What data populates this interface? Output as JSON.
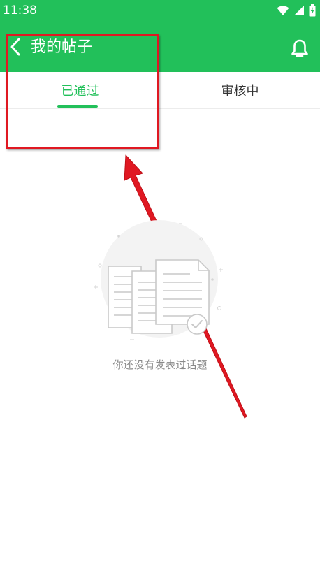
{
  "status_bar": {
    "time": "11:38",
    "icons": [
      "wifi-icon",
      "cell-signal-icon",
      "battery-charging-icon"
    ]
  },
  "header": {
    "title": "我的帖子",
    "back_icon": "chevron-left-icon",
    "notification_icon": "bell-icon"
  },
  "tabs": [
    {
      "label": "已通过",
      "active": true
    },
    {
      "label": "审核中",
      "active": false
    }
  ],
  "empty_state": {
    "message": "你还没有发表过话题",
    "icon": "empty-documents-icon"
  },
  "colors": {
    "primary": "#22c05a",
    "annotation": "#e01822",
    "text": "#333333",
    "muted": "#8a8a8a"
  }
}
